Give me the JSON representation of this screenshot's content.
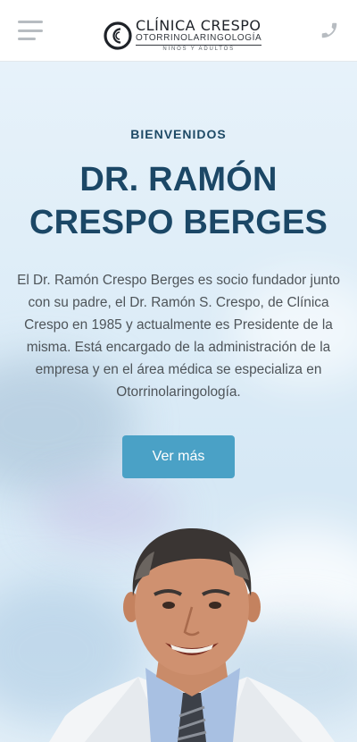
{
  "header": {
    "menu_icon": "hamburger-menu-icon",
    "logo_name": "CLÍNICA CRESPO",
    "logo_specialty": "OTORRINOLARINGOLOGÍA",
    "logo_subtitle": "NIÑOS Y ADULTOS",
    "phone_icon": "phone-icon"
  },
  "hero": {
    "eyebrow": "BIENVENIDOS",
    "title_line1": "DR. RAMÓN",
    "title_line2": "CRESPO BERGES",
    "bio": "El Dr. Ramón Crespo Berges es socio fundador junto con su padre, el Dr. Ramón S. Crespo, de Clínica Crespo en 1985 y actualmente es Presidente de la misma. Está encargado de la administración de la empresa y en el área médica se especializa en Otorrinolaringología.",
    "cta_label": "Ver más"
  },
  "colors": {
    "brand_dark": "#1b4766",
    "accent": "#4aa1c6",
    "body_text": "#4e5459",
    "icon_gray": "#b7bcc1"
  }
}
